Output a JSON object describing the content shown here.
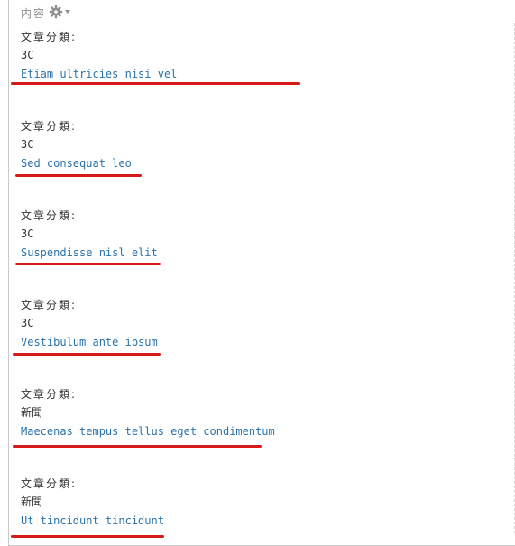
{
  "panel": {
    "title": "内容",
    "settings_icon": "gear-icon",
    "dropdown_icon": "caret-down-icon"
  },
  "entries": [
    {
      "label": "文章分類:",
      "category": "3C",
      "title": "Etiam ultricies nisi vel"
    },
    {
      "label": "文章分類:",
      "category": "3C",
      "title": "Sed consequat leo"
    },
    {
      "label": "文章分類:",
      "category": "3C",
      "title": "Suspendisse nisl elit"
    },
    {
      "label": "文章分類:",
      "category": "3C",
      "title": "Vestibulum ante ipsum"
    },
    {
      "label": "文章分類:",
      "category": "新聞",
      "title": "Maecenas tempus tellus eget condimentum"
    },
    {
      "label": "文章分類:",
      "category": "新聞",
      "title": "Ut tincidunt tincidunt"
    }
  ],
  "colors": {
    "link": "#2b72a8",
    "text": "#333333",
    "annotation": "#d61a1a",
    "muted": "#8f8f8f"
  }
}
